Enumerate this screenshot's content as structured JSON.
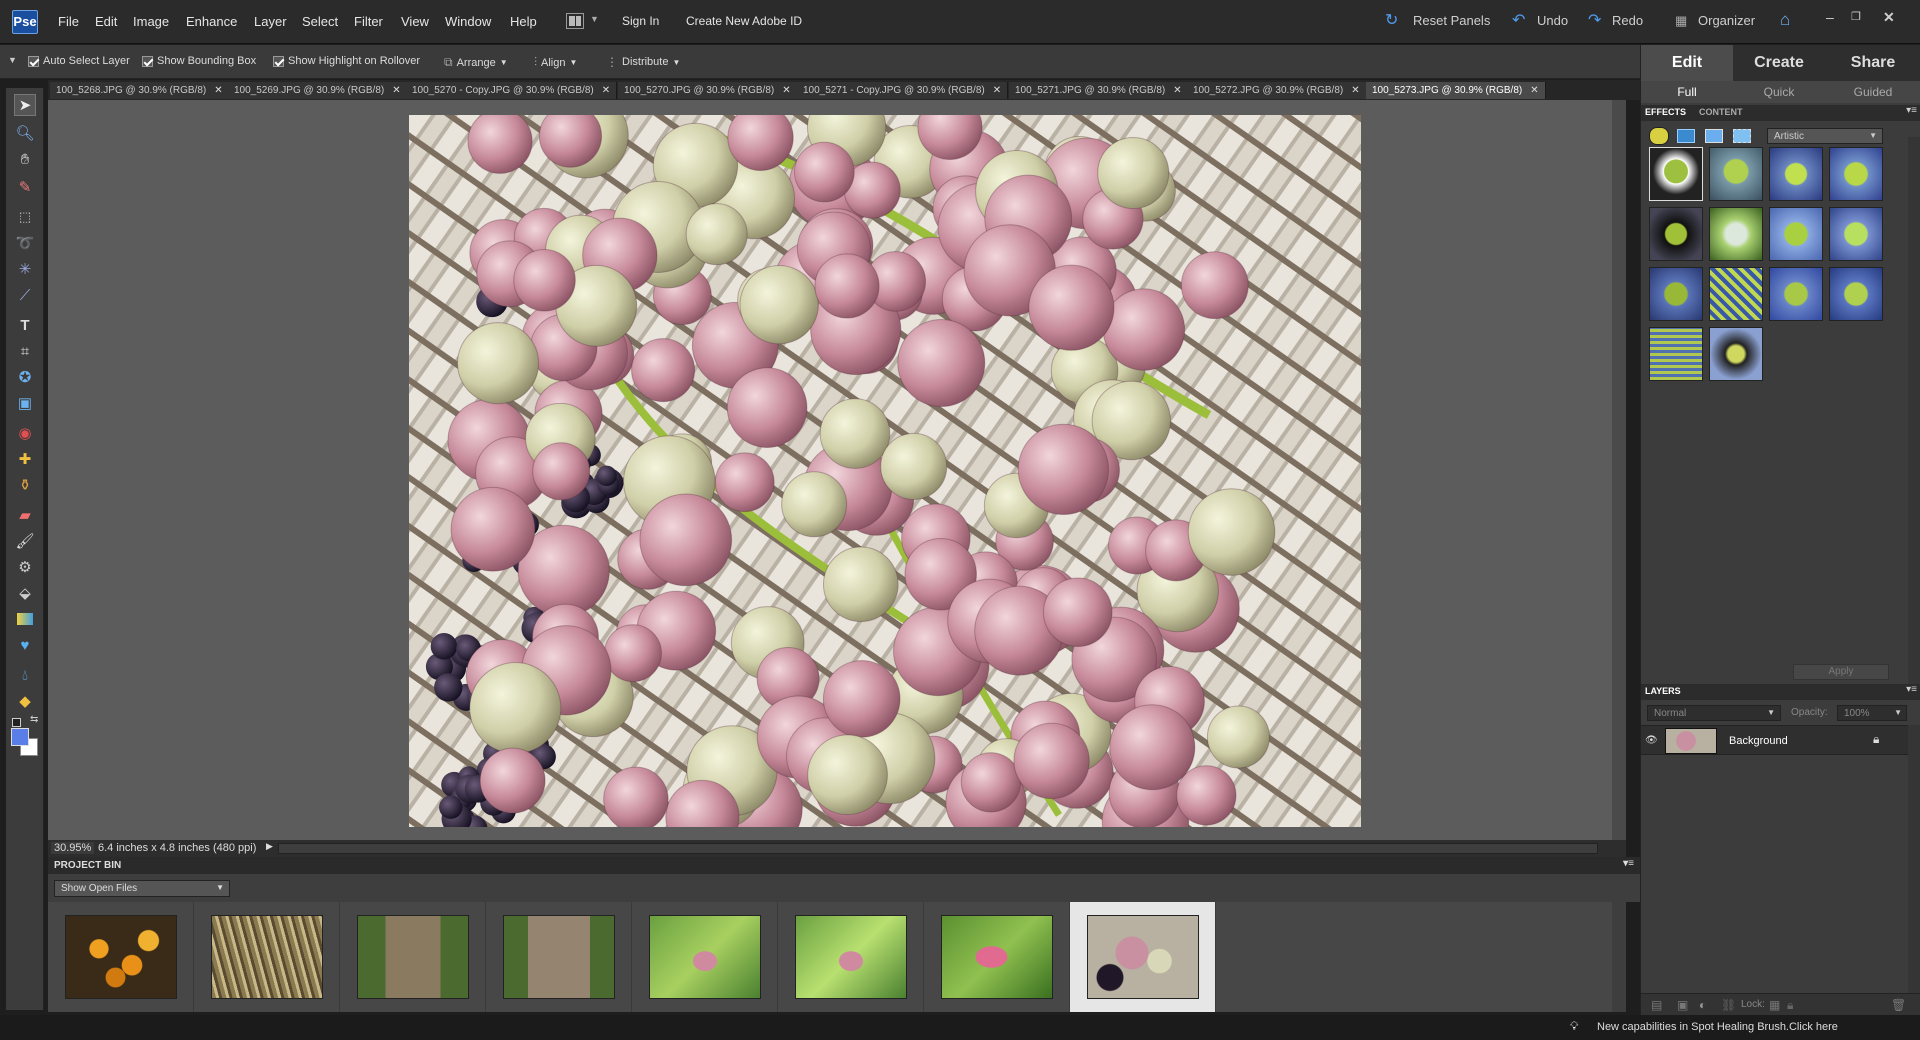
{
  "menubar": {
    "items": [
      "File",
      "Edit",
      "Image",
      "Enhance",
      "Layer",
      "Select",
      "Filter",
      "View",
      "Window",
      "Help"
    ],
    "sign_in": "Sign In",
    "create_id": "Create New Adobe ID",
    "reset_panels": "Reset Panels",
    "undo": "Undo",
    "redo": "Redo",
    "organizer": "Organizer"
  },
  "options": {
    "auto_select_layer": "Auto Select Layer",
    "show_bounding_box": "Show Bounding Box",
    "show_highlight": "Show Highlight on Rollover",
    "arrange": "Arrange",
    "align": "Align",
    "distribute": "Distribute"
  },
  "tabs": [
    "100_5268.JPG @ 30.9% (RGB/8)",
    "100_5269.JPG @ 30.9% (RGB/8)",
    "100_5270 - Copy.JPG @ 30.9% (RGB/8)",
    "100_5270.JPG @ 30.9% (RGB/8)",
    "100_5271 - Copy.JPG @ 30.9% (RGB/8)",
    "100_5271.JPG @ 30.9% (RGB/8)",
    "100_5272.JPG @ 30.9% (RGB/8)",
    "100_5273.JPG @ 30.9% (RGB/8)"
  ],
  "status": {
    "zoom": "30.95%",
    "doc_size": "6.4 inches x 4.8 inches (480 ppi)"
  },
  "project_bin": {
    "title": "PROJECT BIN",
    "show": "Show Open Files"
  },
  "panel": {
    "modes": [
      "Edit",
      "Create",
      "Share"
    ],
    "submodes": [
      "Full",
      "Quick",
      "Guided"
    ],
    "effects_tab": "EFFECTS",
    "content_tab": "CONTENT",
    "category": "Artistic",
    "apply": "Apply",
    "layers_title": "LAYERS",
    "blend_mode": "Normal",
    "opacity_label": "Opacity:",
    "opacity_value": "100%",
    "layer_name": "Background",
    "lock_label": "Lock:"
  },
  "tip": "New capabilities in Spot Healing Brush.Click here",
  "colors": {
    "accent": "#2e6fcf",
    "foreground_swatch": "#5a7ee8",
    "background_swatch": "#ffffff"
  }
}
